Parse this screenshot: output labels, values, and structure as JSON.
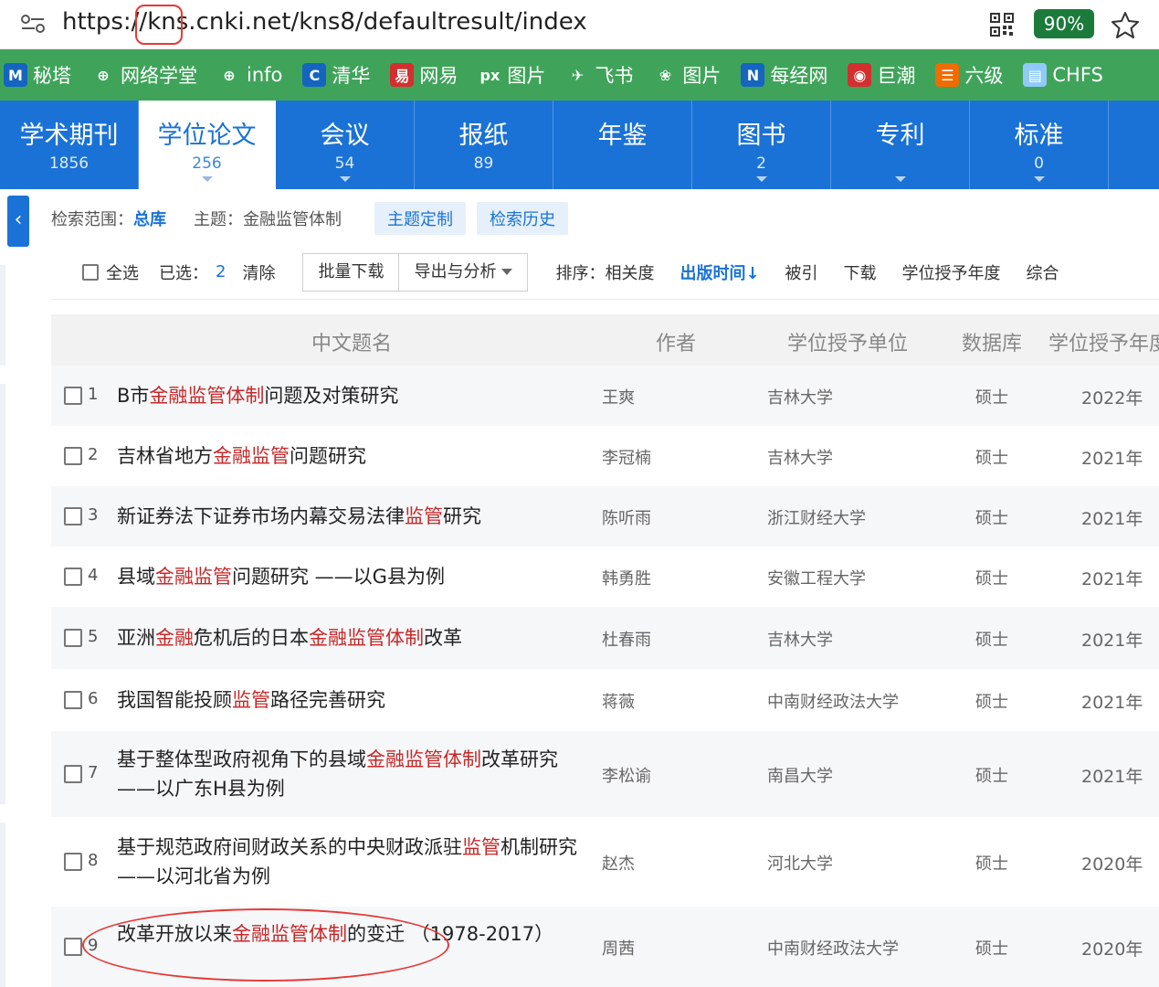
{
  "url": {
    "prefix": "https://",
    "host_a": "kns.",
    "host_b": "cnki.net/kns8/defaultresult/index",
    "zoom": "90%"
  },
  "bookmarks": [
    {
      "icon": "mita-icon",
      "glyph": "M",
      "color": "#1565c0",
      "label": "秘塔"
    },
    {
      "icon": "globe-icon",
      "glyph": "⊕",
      "color": "transparent",
      "label": "网络学堂"
    },
    {
      "icon": "globe-icon",
      "glyph": "⊕",
      "color": "transparent",
      "label": "info"
    },
    {
      "icon": "c-icon",
      "glyph": "C",
      "color": "#1565c0",
      "label": "清华"
    },
    {
      "icon": "netease-icon",
      "glyph": "易",
      "color": "#d32f2f",
      "label": "网易"
    },
    {
      "icon": "px-icon",
      "glyph": "px",
      "color": "transparent",
      "label": "图片"
    },
    {
      "icon": "feishu-icon",
      "glyph": "✈",
      "color": "transparent",
      "label": "飞书"
    },
    {
      "icon": "baidu-icon",
      "glyph": "❀",
      "color": "transparent",
      "label": "图片"
    },
    {
      "icon": "nbd-icon",
      "glyph": "N",
      "color": "#1565c0",
      "label": "每经网"
    },
    {
      "icon": "cninfo-icon",
      "glyph": "◉",
      "color": "#d32f2f",
      "label": "巨潮"
    },
    {
      "icon": "list-icon",
      "glyph": "☰",
      "color": "#ef6c00",
      "label": "六级"
    },
    {
      "icon": "doc-icon",
      "glyph": "▤",
      "color": "#90caf9",
      "label": "CHFS"
    }
  ],
  "tabs": [
    {
      "label": "学术期刊",
      "count": "1856",
      "active": false,
      "caret": false
    },
    {
      "label": "学位论文",
      "count": "256",
      "active": true,
      "caret": true
    },
    {
      "label": "会议",
      "count": "54",
      "active": false,
      "caret": true
    },
    {
      "label": "报纸",
      "count": "89",
      "active": false,
      "caret": false
    },
    {
      "label": "年鉴",
      "count": "",
      "active": false,
      "caret": false
    },
    {
      "label": "图书",
      "count": "2",
      "active": false,
      "caret": true
    },
    {
      "label": "专利",
      "count": "",
      "active": false,
      "caret": true
    },
    {
      "label": "标准",
      "count": "0",
      "active": false,
      "caret": true
    }
  ],
  "scope": {
    "range_label": "检索范围：",
    "range_value": "总库",
    "topic_label": "主题：",
    "topic_value": "金融监管体制",
    "chip1": "主题定制",
    "chip2": "检索历史"
  },
  "toolbar": {
    "select_all": "全选",
    "selected_label": "已选：",
    "selected_count": "2",
    "clear": "清除",
    "batch_download": "批量下载",
    "export": "导出与分析",
    "sort_label": "排序：",
    "sort_items": [
      {
        "label": "相关度",
        "active": false
      },
      {
        "label": "出版时间↓",
        "active": true
      },
      {
        "label": "被引",
        "active": false
      },
      {
        "label": "下载",
        "active": false
      },
      {
        "label": "学位授予年度",
        "active": false
      },
      {
        "label": "综合",
        "active": false
      }
    ]
  },
  "table": {
    "headers": {
      "title": "中文题名",
      "author": "作者",
      "unit": "学位授予单位",
      "db": "数据库",
      "year": "学位授予年度"
    },
    "rows": [
      {
        "num": "1",
        "title": [
          {
            "t": "B市"
          },
          {
            "t": "金融监管体制",
            "hl": true
          },
          {
            "t": "问题及对策研究"
          }
        ],
        "author": "王爽",
        "unit": "吉林大学",
        "db": "硕士",
        "year": "2022年"
      },
      {
        "num": "2",
        "title": [
          {
            "t": "吉林省地方"
          },
          {
            "t": "金融监管",
            "hl": true
          },
          {
            "t": "问题研究"
          }
        ],
        "author": "李冠楠",
        "unit": "吉林大学",
        "db": "硕士",
        "year": "2021年"
      },
      {
        "num": "3",
        "title": [
          {
            "t": "新证券法下证券市场内幕交易法律"
          },
          {
            "t": "监管",
            "hl": true
          },
          {
            "t": "研究"
          }
        ],
        "author": "陈听雨",
        "unit": "浙江财经大学",
        "db": "硕士",
        "year": "2021年"
      },
      {
        "num": "4",
        "title": [
          {
            "t": "县域"
          },
          {
            "t": "金融监管",
            "hl": true
          },
          {
            "t": "问题研究 ——以G县为例"
          }
        ],
        "author": "韩勇胜",
        "unit": "安徽工程大学",
        "db": "硕士",
        "year": "2021年"
      },
      {
        "num": "5",
        "title": [
          {
            "t": "亚洲"
          },
          {
            "t": "金融",
            "hl": true
          },
          {
            "t": "危机后的日本"
          },
          {
            "t": "金融监管体制",
            "hl": true
          },
          {
            "t": "改革"
          }
        ],
        "author": "杜春雨",
        "unit": "吉林大学",
        "db": "硕士",
        "year": "2021年"
      },
      {
        "num": "6",
        "title": [
          {
            "t": "我国智能投顾"
          },
          {
            "t": "监管",
            "hl": true
          },
          {
            "t": "路径完善研究"
          }
        ],
        "author": "蒋薇",
        "unit": "中南财经政法大学",
        "db": "硕士",
        "year": "2021年"
      },
      {
        "num": "7",
        "title": [
          {
            "t": "基于整体型政府视角下的县域"
          },
          {
            "t": "金融监管体制",
            "hl": true
          },
          {
            "t": "改革研究 ——以广东H县为例"
          }
        ],
        "author": "李松谕",
        "unit": "南昌大学",
        "db": "硕士",
        "year": "2021年"
      },
      {
        "num": "8",
        "title": [
          {
            "t": "基于规范政府间财政关系的中央财政派驻"
          },
          {
            "t": "监管",
            "hl": true
          },
          {
            "t": "机制研究 ——以河北省为例"
          }
        ],
        "author": "赵杰",
        "unit": "河北大学",
        "db": "硕士",
        "year": "2020年"
      },
      {
        "num": "9",
        "title": [
          {
            "t": "改革开放以来"
          },
          {
            "t": "金融监管体制",
            "hl": true
          },
          {
            "t": "的变迁 （1978-2017）"
          }
        ],
        "author": "周茜",
        "unit": "中南财经政法大学",
        "db": "硕士",
        "year": "2020年"
      }
    ]
  }
}
